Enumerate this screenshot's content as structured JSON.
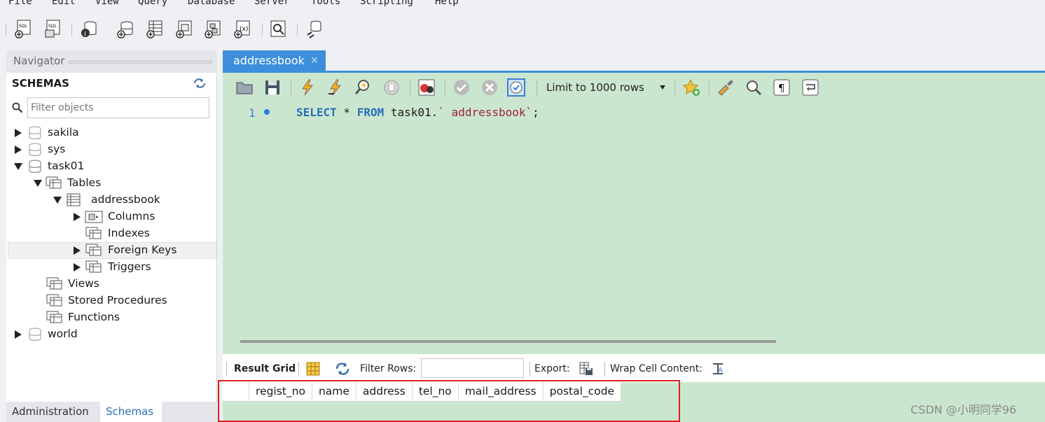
{
  "menu": [
    "File",
    "Edit",
    "View",
    "Query",
    "Database",
    "Server",
    "Tools",
    "Scripting",
    "Help"
  ],
  "navigator": {
    "title": "Navigator",
    "schemas_heading": "SCHEMAS",
    "filter_placeholder": "Filter objects",
    "tree": {
      "sakila": "sakila",
      "sys": "sys",
      "task01": "task01",
      "tables": "Tables",
      "addressbook": "addressbook",
      "columns": "Columns",
      "indexes": "Indexes",
      "foreign_keys": "Foreign Keys",
      "triggers": "Triggers",
      "views": "Views",
      "stored_procedures": "Stored Procedures",
      "functions": "Functions",
      "world": "world"
    },
    "bottom_tabs": {
      "administration": "Administration",
      "schemas": "Schemas"
    }
  },
  "editor": {
    "tab_label": "addressbook",
    "tab_close": "×",
    "limit_label": "Limit to 1000 rows",
    "line_number": "1",
    "sql": {
      "select": "SELECT",
      "star": " * ",
      "from": "FROM",
      "schema": " task01.",
      "table": "` addressbook`",
      "semicolon": ";"
    }
  },
  "results": {
    "result_grid_label": "Result Grid",
    "filter_rows_label": "Filter Rows:",
    "export_label": "Export:",
    "wrap_label": "Wrap Cell Content:",
    "columns": [
      "regist_no",
      "name",
      "address",
      "tel_no",
      "mail_address",
      "postal_code"
    ]
  },
  "watermark": "CSDN @小明同学96",
  "colors": {
    "accent": "#3d8fdc",
    "editor_bg": "#cbe6cf",
    "highlight": "#e02020"
  }
}
